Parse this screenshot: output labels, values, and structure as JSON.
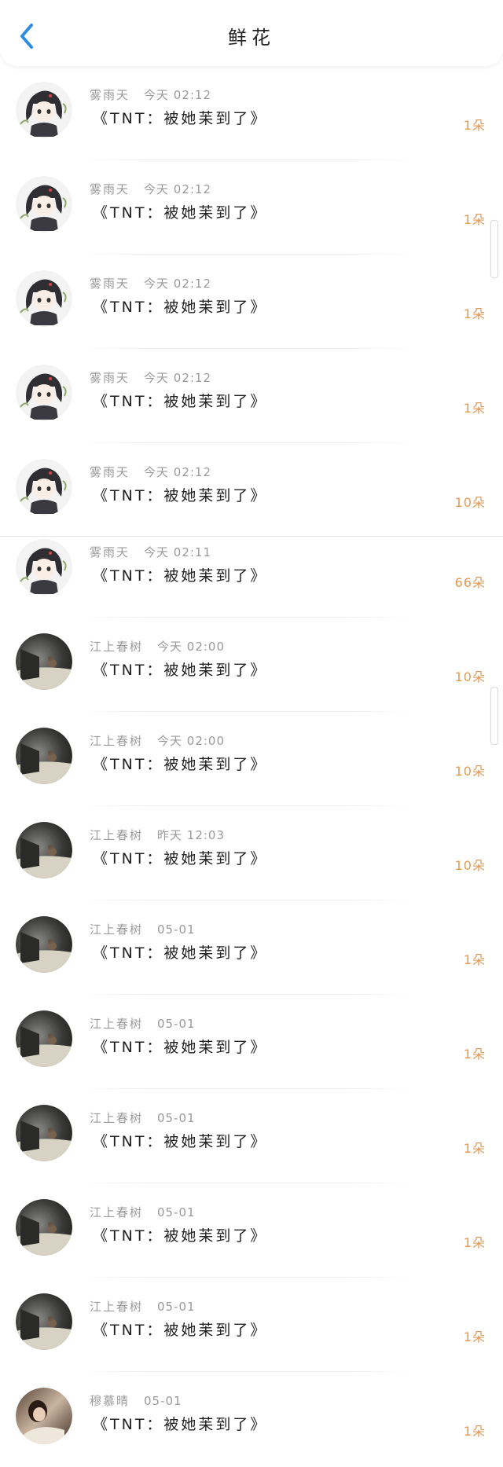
{
  "header": {
    "title": "鲜花",
    "back_icon": "chevron-left-icon",
    "accent_color": "#2d8ee6"
  },
  "colors": {
    "amount": "#e09a55",
    "meta": "#9a9a9a"
  },
  "items": [
    {
      "user": "雾雨天",
      "time": "今天 02:12",
      "work": "《TNT：被她苿到了》",
      "amount": "1朵",
      "avatar": "anime-girl-avatar"
    },
    {
      "user": "雾雨天",
      "time": "今天 02:12",
      "work": "《TNT：被她苿到了》",
      "amount": "1朵",
      "avatar": "anime-girl-avatar"
    },
    {
      "user": "雾雨天",
      "time": "今天 02:12",
      "work": "《TNT：被她苿到了》",
      "amount": "1朵",
      "avatar": "anime-girl-avatar"
    },
    {
      "user": "雾雨天",
      "time": "今天 02:12",
      "work": "《TNT：被她苿到了》",
      "amount": "1朵",
      "avatar": "anime-girl-avatar"
    },
    {
      "user": "雾雨天",
      "time": "今天 02:12",
      "work": "《TNT：被她苿到了》",
      "amount": "10朵",
      "avatar": "anime-girl-avatar"
    },
    {
      "user": "雾雨天",
      "time": "今天 02:11",
      "work": "《TNT：被她苿到了》",
      "amount": "66朵",
      "avatar": "anime-girl-avatar"
    },
    {
      "user": "江上春树",
      "time": "今天 02:00",
      "work": "《TNT：被她苿到了》",
      "amount": "10朵",
      "avatar": "cat-photo-avatar"
    },
    {
      "user": "江上春树",
      "time": "今天 02:00",
      "work": "《TNT：被她苿到了》",
      "amount": "10朵",
      "avatar": "cat-photo-avatar"
    },
    {
      "user": "江上春树",
      "time": "昨天 12:03",
      "work": "《TNT：被她苿到了》",
      "amount": "10朵",
      "avatar": "cat-photo-avatar"
    },
    {
      "user": "江上春树",
      "time": "05-01",
      "work": "《TNT：被她苿到了》",
      "amount": "1朵",
      "avatar": "cat-photo-avatar"
    },
    {
      "user": "江上春树",
      "time": "05-01",
      "work": "《TNT：被她苿到了》",
      "amount": "1朵",
      "avatar": "cat-photo-avatar"
    },
    {
      "user": "江上春树",
      "time": "05-01",
      "work": "《TNT：被她苿到了》",
      "amount": "1朵",
      "avatar": "cat-photo-avatar"
    },
    {
      "user": "江上春树",
      "time": "05-01",
      "work": "《TNT：被她苿到了》",
      "amount": "1朵",
      "avatar": "cat-photo-avatar"
    },
    {
      "user": "江上春树",
      "time": "05-01",
      "work": "《TNT：被她苿到了》",
      "amount": "1朵",
      "avatar": "cat-photo-avatar"
    },
    {
      "user": "穆慕晴",
      "time": "05-01",
      "work": "《TNT：被她苿到了》",
      "amount": "1朵",
      "avatar": "person-photo-avatar"
    }
  ]
}
